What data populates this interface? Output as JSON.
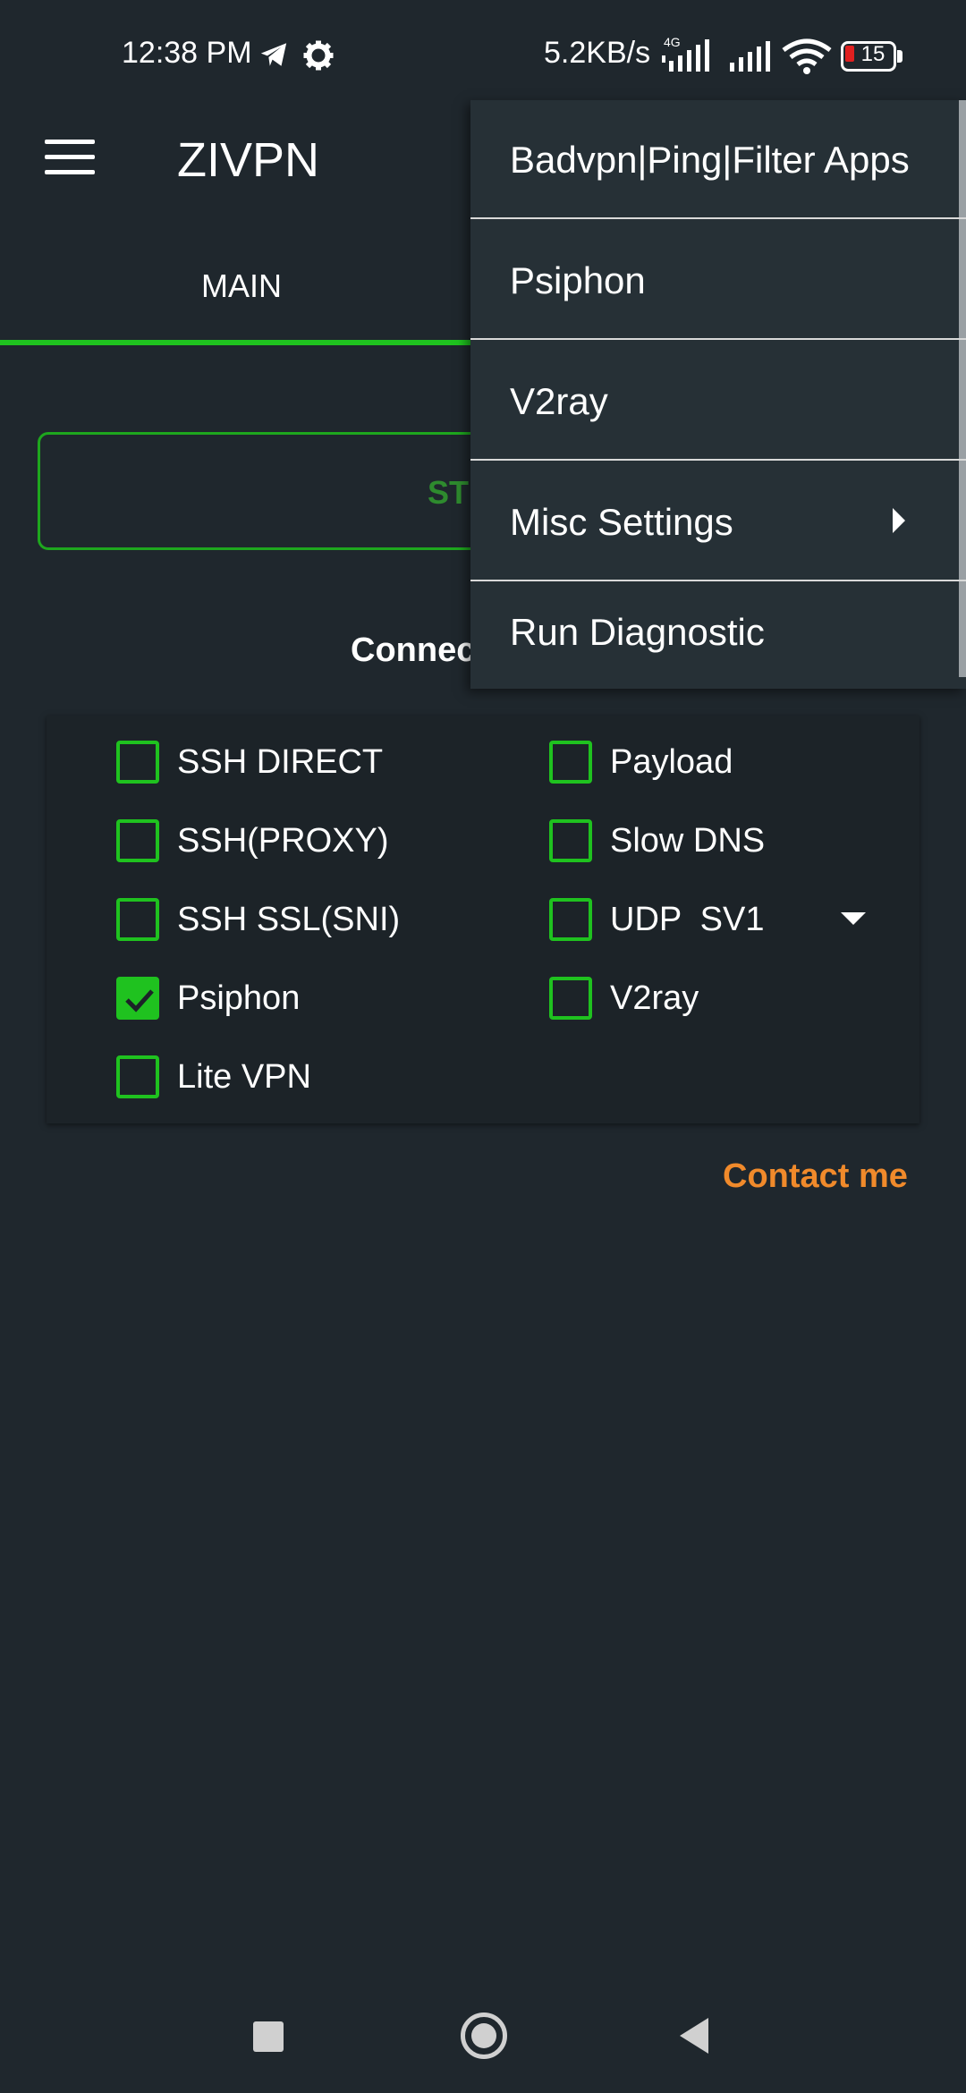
{
  "status_bar": {
    "time": "12:38 PM",
    "net_speed": "5.2KB/s",
    "network_type": "4G",
    "battery_level": "15",
    "icons": [
      "telegram-icon",
      "gear-icon",
      "signal-icon",
      "signal-icon",
      "wifi-icon",
      "battery-icon"
    ]
  },
  "app_bar": {
    "title": "ZIVPN",
    "menu_icon": "hamburger-menu-icon"
  },
  "tabs": [
    {
      "label": "MAIN",
      "selected": true
    }
  ],
  "start_button": {
    "label_visible": "ST"
  },
  "connection_label_visible": "Connec",
  "options": {
    "left": [
      {
        "label": "SSH DIRECT",
        "checked": false
      },
      {
        "label": "SSH(PROXY)",
        "checked": false
      },
      {
        "label": "SSH SSL(SNI)",
        "checked": false
      },
      {
        "label": "Psiphon",
        "checked": true
      },
      {
        "label": "Lite VPN",
        "checked": false
      }
    ],
    "right": [
      {
        "label": "Payload",
        "checked": false
      },
      {
        "label": "Slow DNS",
        "checked": false
      },
      {
        "label": "UDP  SV1",
        "checked": false
      },
      {
        "label": "V2ray",
        "checked": false
      }
    ]
  },
  "contact_link": "Contact me",
  "popup_menu": {
    "items": [
      {
        "label": "Badvpn|Ping|Filter Apps"
      },
      {
        "label": "Psiphon"
      },
      {
        "label": "V2ray"
      },
      {
        "label": "Misc Settings",
        "has_submenu": true
      },
      {
        "label": "Run Diagnostic"
      }
    ]
  },
  "colors": {
    "background": "#1f272d",
    "accent_green": "#1fc21f",
    "contact_orange": "#f08a2b",
    "popup_bg": "#263036"
  }
}
